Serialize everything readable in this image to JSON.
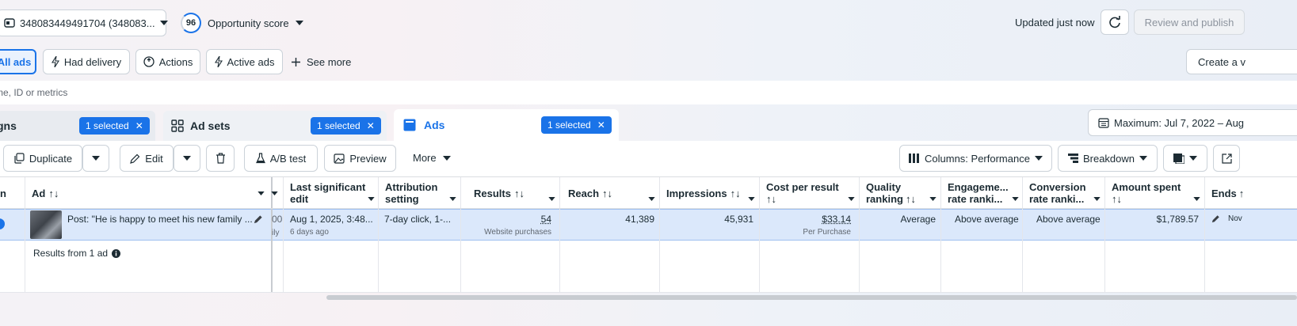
{
  "header": {
    "account_label": "348083449491704 (348083...",
    "opportunity_score_value": "96",
    "opportunity_score_label": "Opportunity score",
    "updated_text": "Updated just now",
    "review_publish_label": "Review and publish"
  },
  "filters": {
    "all_ads": "All ads",
    "had_delivery": "Had delivery",
    "actions": "Actions",
    "active_ads": "Active ads",
    "see_more": "See more",
    "create_view": "Create a v"
  },
  "search": {
    "placeholder": "me, ID or metrics"
  },
  "tabs": {
    "campaigns": "gns",
    "campaigns_badge": "1 selected",
    "adsets": "Ad sets",
    "adsets_badge": "1 selected",
    "ads": "Ads",
    "ads_badge": "1 selected",
    "date_range": "Maximum: Jul 7, 2022 – Aug"
  },
  "toolbar": {
    "duplicate": "Duplicate",
    "edit": "Edit",
    "ab_test": "A/B test",
    "preview": "Preview",
    "more": "More",
    "columns": "Columns: Performance",
    "breakdown": "Breakdown"
  },
  "table": {
    "headers": {
      "col0": "n",
      "ad": "Ad",
      "last_edit_1": "Last significant",
      "last_edit_2": "edit",
      "attribution_1": "Attribution",
      "attribution_2": "setting",
      "results": "Results",
      "reach": "Reach",
      "impressions": "Impressions",
      "cpr_1": "Cost per result",
      "quality_1": "Quality",
      "quality_2": "ranking",
      "engagement_1": "Engageme...",
      "engagement_2": "rate ranki...",
      "conversion_1": "Conversion",
      "conversion_2": "rate ranki...",
      "amount_1": "Amount spent",
      "ends": "Ends"
    },
    "row": {
      "ad_name": "Post: \"He is happy to meet his new family ...",
      "partial_col": "00",
      "partial_col_sub": "ily",
      "last_edit": "Aug 1, 2025, 3:48...",
      "last_edit_sub": "6 days ago",
      "attribution": "7-day click, 1-...",
      "results": "54",
      "results_sub": "Website purchases",
      "reach": "41,389",
      "impressions": "45,931",
      "cpr": "$33.14",
      "cpr_sub": "Per Purchase",
      "quality": "Average",
      "engagement": "Above average",
      "conversion": "Above average",
      "amount": "$1,789.57",
      "ends": "Nov"
    },
    "summary": "Results from 1 ad"
  },
  "colors": {
    "accent": "#1a73e8",
    "selected_row": "#dbe8fb"
  }
}
